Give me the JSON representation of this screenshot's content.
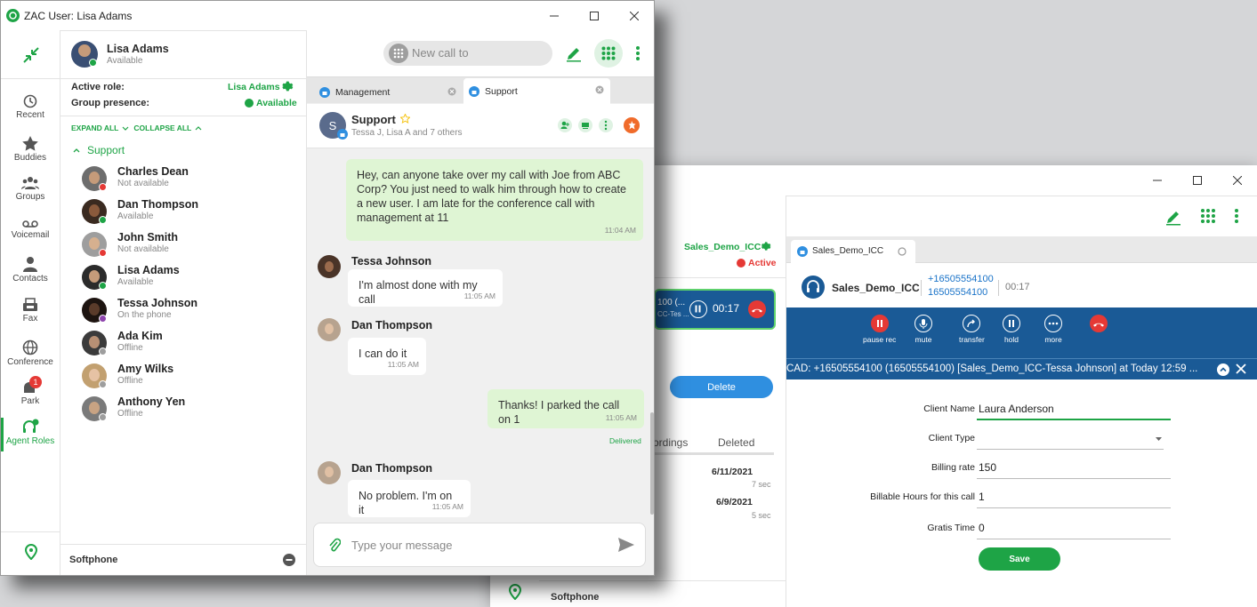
{
  "colors": {
    "accent": "#1ea446",
    "call_bar": "#1a5a96",
    "end_call": "#e53935",
    "chat_bg": "#f0f0f0",
    "own_bubble": "#dff5d4"
  },
  "w1": {
    "title": "ZAC User: Lisa Adams",
    "user": {
      "name": "Lisa Adams",
      "status": "Available"
    },
    "new_call_placeholder": "New call to",
    "active_role_label": "Active role:",
    "active_role_value": "Lisa Adams",
    "group_presence_label": "Group presence:",
    "group_presence_value": "Available",
    "expand_all": "EXPAND ALL",
    "collapse_all": "COLLAPSE ALL",
    "group_name": "Support",
    "rail": [
      {
        "label": "Recent",
        "icon": "clock-icon"
      },
      {
        "label": "Buddies",
        "icon": "star-icon"
      },
      {
        "label": "Groups",
        "icon": "groups-icon"
      },
      {
        "label": "Voicemail",
        "icon": "voicemail-icon"
      },
      {
        "label": "Contacts",
        "icon": "contacts-icon"
      },
      {
        "label": "Fax",
        "icon": "fax-icon"
      },
      {
        "label": "Conference",
        "icon": "globe-icon"
      },
      {
        "label": "Park",
        "icon": "park-icon",
        "badge": "1"
      },
      {
        "label": "Agent Roles",
        "icon": "agent-roles-icon"
      }
    ],
    "contacts": [
      {
        "name": "Charles Dean",
        "status": "Not available",
        "presence": "#e53935"
      },
      {
        "name": "Dan Thompson",
        "status": "Available",
        "presence": "#1ea446"
      },
      {
        "name": "John Smith",
        "status": "Not available",
        "presence": "#e53935"
      },
      {
        "name": "Lisa Adams",
        "status": "Available",
        "presence": "#1ea446"
      },
      {
        "name": "Tessa Johnson",
        "status": "On the phone",
        "presence": "#8e44ad"
      },
      {
        "name": "Ada Kim",
        "status": "Offline",
        "presence": "#9e9e9e"
      },
      {
        "name": "Amy Wilks",
        "status": "Offline",
        "presence": "#9e9e9e"
      },
      {
        "name": "Anthony Yen",
        "status": "Offline",
        "presence": "#9e9e9e"
      }
    ],
    "softphone": "Softphone",
    "tabs": [
      {
        "label": "Management"
      },
      {
        "label": "Support"
      }
    ],
    "chat_header": {
      "title": "Support",
      "subtitle": "Tessa J, Lisa A and 7 others",
      "avatar_letter": "S"
    },
    "messages": [
      {
        "text": "Hey, can anyone take over my call with Joe from ABC Corp? You just need to walk him through how to create a new user. I am late for the conference call with management at 11",
        "time": "11:04 AM"
      },
      {
        "sender": "Tessa Johnson",
        "text": "I'm almost done with my call",
        "time": "11:05 AM"
      },
      {
        "sender": "Dan Thompson",
        "text": "I can do it",
        "time": "11:05 AM"
      },
      {
        "text": "Thanks! I parked the call on 1",
        "time": "11:05 AM",
        "receipt": "Delivered"
      },
      {
        "sender": "Dan Thompson",
        "text": "No problem. I'm on it",
        "time": "11:05 AM"
      }
    ],
    "compose_placeholder": "Type your message"
  },
  "w2": {
    "role_name": "Sales_Demo_ICC",
    "role_status": "Active",
    "mini_call": {
      "line1": "100 (...",
      "line2": "CC-Tes ...",
      "timer": "00:17"
    },
    "delete_label": "Delete",
    "rec_tabs": {
      "recordings": "ordings",
      "deleted": "Deleted"
    },
    "recordings": [
      {
        "date": "6/11/2021",
        "dur": "7 sec"
      },
      {
        "date": "6/9/2021",
        "dur": "5 sec"
      }
    ],
    "softphone": "Softphone",
    "tab_label": "Sales_Demo_ICC",
    "call": {
      "name": "Sales_Demo_ICC",
      "number1": "+16505554100",
      "number2": "16505554100",
      "timer": "00:17"
    },
    "controls": [
      {
        "label": "pause rec",
        "icon": "pause-rec-icon"
      },
      {
        "label": "mute",
        "icon": "mic-icon"
      },
      {
        "label": "transfer",
        "icon": "transfer-icon"
      },
      {
        "label": "hold",
        "icon": "hold-icon"
      },
      {
        "label": "more",
        "icon": "more-icon"
      }
    ],
    "cad_title": "CAD: +16505554100 (16505554100) [Sales_Demo_ICC-Tessa Johnson] at Today 12:59 ...",
    "form": [
      {
        "label": "Client Name",
        "value": "Laura Anderson"
      },
      {
        "label": "Client Type",
        "value": ""
      },
      {
        "label": "Billing rate",
        "value": "150"
      },
      {
        "label": "Billable Hours for this call",
        "value": "1"
      },
      {
        "label": "Gratis Time",
        "value": "0"
      }
    ],
    "save_label": "Save"
  }
}
